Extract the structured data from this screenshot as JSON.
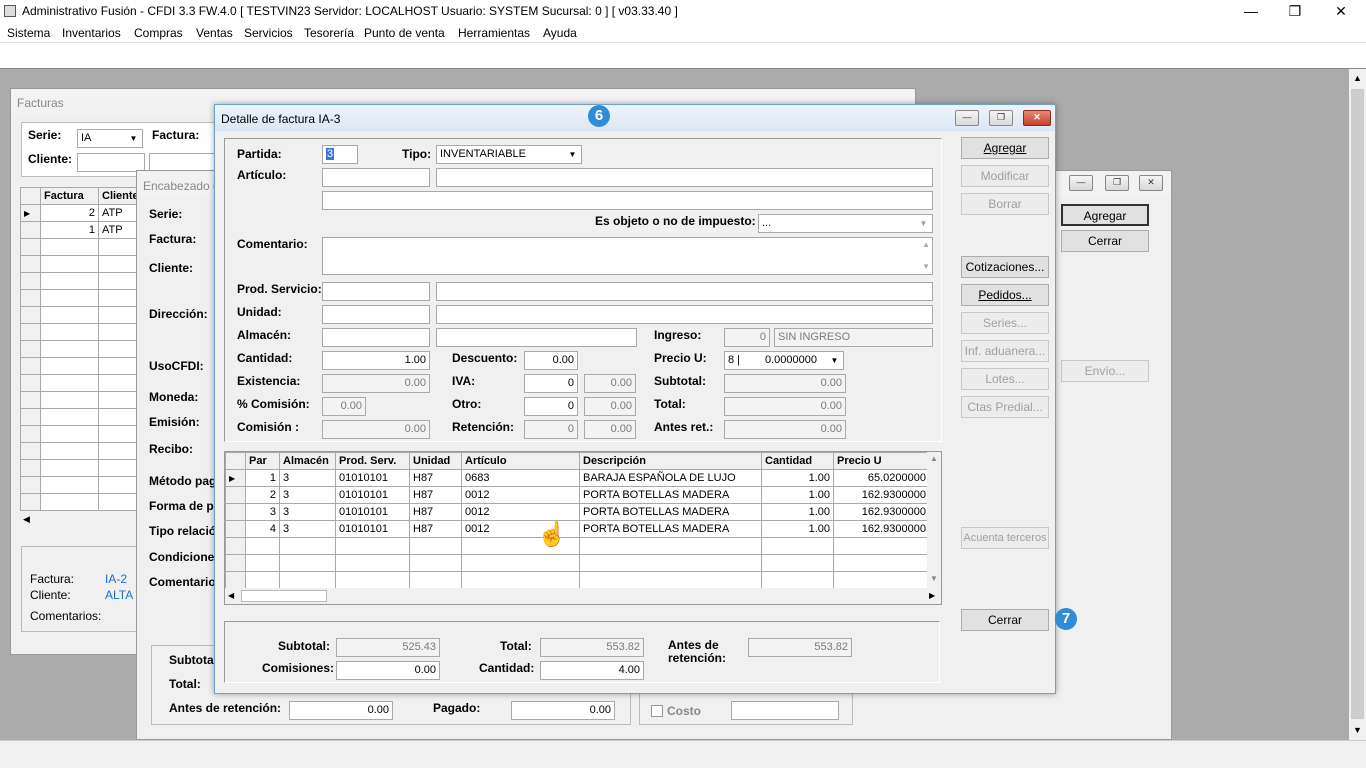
{
  "app": {
    "title": "Administrativo Fusión - CFDI 3.3 FW.4.0 [ TESTVIN23  Servidor: LOCALHOST   Usuario: SYSTEM     Sucursal: 0 ] [ v03.33.40 ]",
    "menu": [
      "Sistema",
      "Inventarios",
      "Compras",
      "Ventas",
      "Servicios",
      "Tesorería",
      "Punto de venta",
      "Herramientas",
      "Ayuda"
    ]
  },
  "facturas_win": {
    "title": "Facturas",
    "serie_label": "Serie:",
    "serie_value": "IA",
    "factura_label": "Factura:",
    "cliente_label": "Cliente:",
    "grid_headers": [
      "Factura",
      "Cliente"
    ],
    "rows": [
      {
        "factura": "2",
        "cliente": "ATP"
      },
      {
        "factura": "1",
        "cliente": "ATP"
      }
    ],
    "info": {
      "factura_label": "Factura:",
      "factura_value": "IA-2",
      "cliente_label": "Cliente:",
      "cliente_value": "ALTA T",
      "comentarios_label": "Comentarios:"
    }
  },
  "encabezado_win": {
    "title": "Encabezado d",
    "labels": {
      "serie": "Serie:",
      "factura": "Factura:",
      "cliente": "Cliente:",
      "direccion": "Dirección:",
      "usocfdi": "UsoCFDI:",
      "moneda": "Moneda:",
      "emision": "Emisión:",
      "recibo": "Recibo:",
      "metodo": "Método pag",
      "forma": "Forma de pa",
      "tipo": "Tipo relació",
      "condiciones": "Condiciones",
      "comentario": "Comentario"
    },
    "agregar": "Agregar",
    "cerrar": "Cerrar",
    "envio": "Envío...",
    "subtotal_label": "Subtotal",
    "total_label": "Total:",
    "antes_label": "Antes de retención:",
    "antes_value": "0.00",
    "pagado_label": "Pagado:",
    "pagado_value": "0.00",
    "costo_label": "Costo"
  },
  "detalle": {
    "title": "Detalle de factura IA-3",
    "badge_top": "6",
    "badge_bottom": "7",
    "partida_label": "Partida:",
    "partida_value": "3",
    "tipo_label": "Tipo:",
    "tipo_value": "INVENTARIABLE",
    "articulo_label": "Artículo:",
    "objeto_label": "Es objeto o no de impuesto:",
    "objeto_value": "...",
    "comentario_label": "Comentario:",
    "prodserv_label": "Prod. Servicio:",
    "unidad_label": "Unidad:",
    "almacen_label": "Almacén:",
    "ingreso_label": "Ingreso:",
    "ingreso_num": "0",
    "ingreso_text": "SIN INGRESO",
    "cantidad_label": "Cantidad:",
    "cantidad_value": "1.00",
    "descuento_label": "Descuento:",
    "descuento_value": "0.00",
    "preciou_label": "Precio U:",
    "preciou_code": "8 |",
    "preciou_value": "0.0000000",
    "existencia_label": "Existencia:",
    "existencia_value": "0.00",
    "iva_label": "IVA:",
    "iva_pct": "0",
    "iva_value": "0.00",
    "subtotal_label": "Subtotal:",
    "subtotal_value": "0.00",
    "comision_pct_label": "% Comisión:",
    "comision_pct_value": "0.00",
    "otro_label": "Otro:",
    "otro_pct": "0",
    "otro_value": "0.00",
    "total_label": "Total:",
    "total_value": "0.00",
    "comision_label": "Comisión :",
    "comision_value": "0.00",
    "retencion_label": "Retención:",
    "retencion_pct": "0",
    "retencion_value": "0.00",
    "antesret_label": "Antes ret.:",
    "antesret_value": "0.00",
    "buttons": {
      "agregar": "Agregar",
      "modificar": "Modificar",
      "borrar": "Borrar",
      "cotizaciones": "Cotizaciones...",
      "pedidos": "Pedidos...",
      "series": "Series...",
      "aduanera": "Inf. aduanera...",
      "lotes": "Lotes...",
      "predial": "Ctas Predial...",
      "terceros": "Acuenta terceros",
      "cerrar": "Cerrar"
    },
    "grid_headers": [
      "Par",
      "Almacén",
      "Prod. Serv.",
      "Unidad",
      "Artículo",
      "Descripción",
      "Cantidad",
      "Precio U"
    ],
    "rows": [
      {
        "par": "1",
        "almacen": "3",
        "prodserv": "01010101",
        "unidad": "H87",
        "articulo": "0683",
        "descripcion": "BARAJA ESPAÑOLA DE LUJO",
        "cantidad": "1.00",
        "precio": "65.0200000"
      },
      {
        "par": "2",
        "almacen": "3",
        "prodserv": "01010101",
        "unidad": "H87",
        "articulo": "0012",
        "descripcion": "PORTA BOTELLAS MADERA",
        "cantidad": "1.00",
        "precio": "162.9300000"
      },
      {
        "par": "3",
        "almacen": "3",
        "prodserv": "01010101",
        "unidad": "H87",
        "articulo": "0012",
        "descripcion": "PORTA BOTELLAS MADERA",
        "cantidad": "1.00",
        "precio": "162.9300000"
      },
      {
        "par": "4",
        "almacen": "3",
        "prodserv": "01010101",
        "unidad": "H87",
        "articulo": "0012",
        "descripcion": "PORTA BOTELLAS MADERA",
        "cantidad": "1.00",
        "precio": "162.9300000"
      }
    ],
    "totals": {
      "subtotal_label": "Subtotal:",
      "subtotal_value": "525.43",
      "total_label": "Total:",
      "total_value": "553.82",
      "antes_label1": "Antes de",
      "antes_label2": "retención:",
      "antes_value": "553.82",
      "comisiones_label": "Comisiones:",
      "comisiones_value": "0.00",
      "cantidad_label": "Cantidad:",
      "cantidad_value": "4.00"
    }
  }
}
